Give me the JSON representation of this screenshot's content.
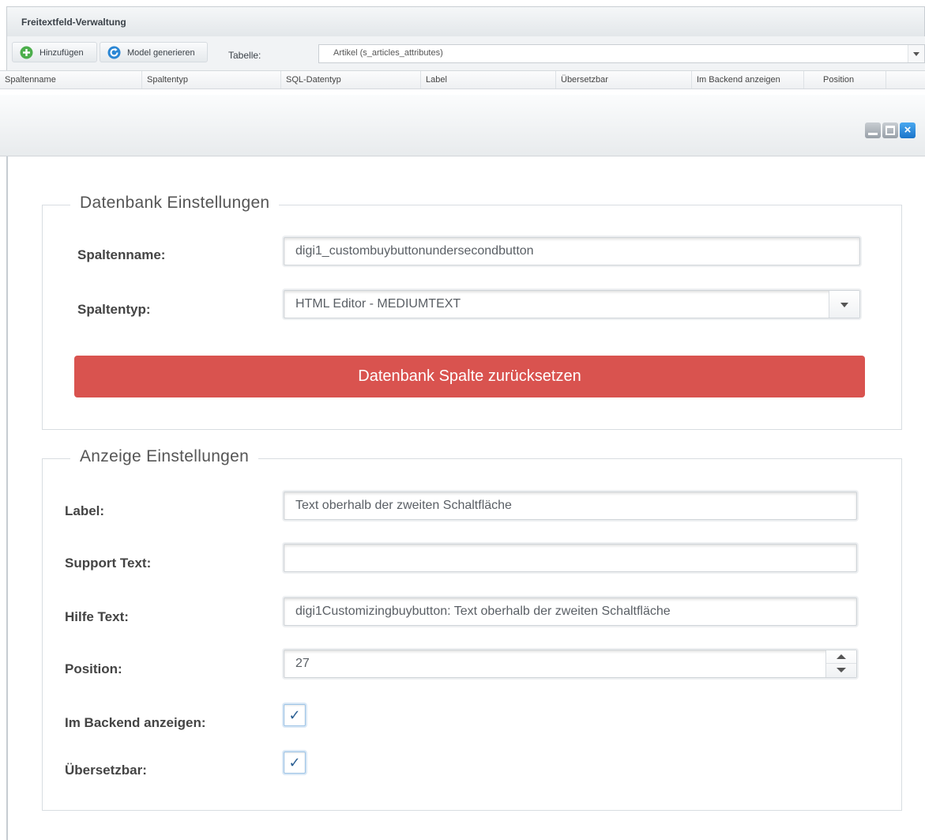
{
  "panel": {
    "title": "Freitextfeld-Verwaltung",
    "toolbar": {
      "add_label": "Hinzufügen",
      "generate_label": "Model generieren",
      "table_label": "Tabelle:",
      "table_value": "Artikel (s_articles_attributes)"
    },
    "columns": [
      "Spaltenname",
      "Spaltentyp",
      "SQL-Datentyp",
      "Label",
      "Übersetzbar",
      "Im Backend anzeigen",
      "Position"
    ]
  },
  "window": {
    "controls": [
      "minimize-icon",
      "maximize-icon",
      "close-icon"
    ]
  },
  "db_settings": {
    "legend": "Datenbank Einstellungen",
    "column_name_label": "Spaltenname:",
    "column_name_value": "digi1_custombuybuttonundersecondbutton",
    "column_type_label": "Spaltentyp:",
    "column_type_value": "HTML Editor - MEDIUMTEXT",
    "reset_button": "Datenbank Spalte zurücksetzen"
  },
  "display_settings": {
    "legend": "Anzeige Einstellungen",
    "label_label": "Label:",
    "label_value": "Text oberhalb der zweiten Schaltfläche",
    "support_label": "Support Text:",
    "support_value": "",
    "help_label": "Hilfe Text:",
    "help_value": "digi1Customizingbuybutton: Text oberhalb der zweiten Schaltfläche",
    "position_label": "Position:",
    "position_value": "27",
    "backend_label": "Im Backend anzeigen:",
    "backend_checked": true,
    "translatable_label": "Übersetzbar:",
    "translatable_checked": true
  },
  "colors": {
    "danger": "#d9534f",
    "checkbox_border": "#9cc3e6",
    "close_blue": "#1a74c9",
    "add_green": "#5cb85c"
  }
}
